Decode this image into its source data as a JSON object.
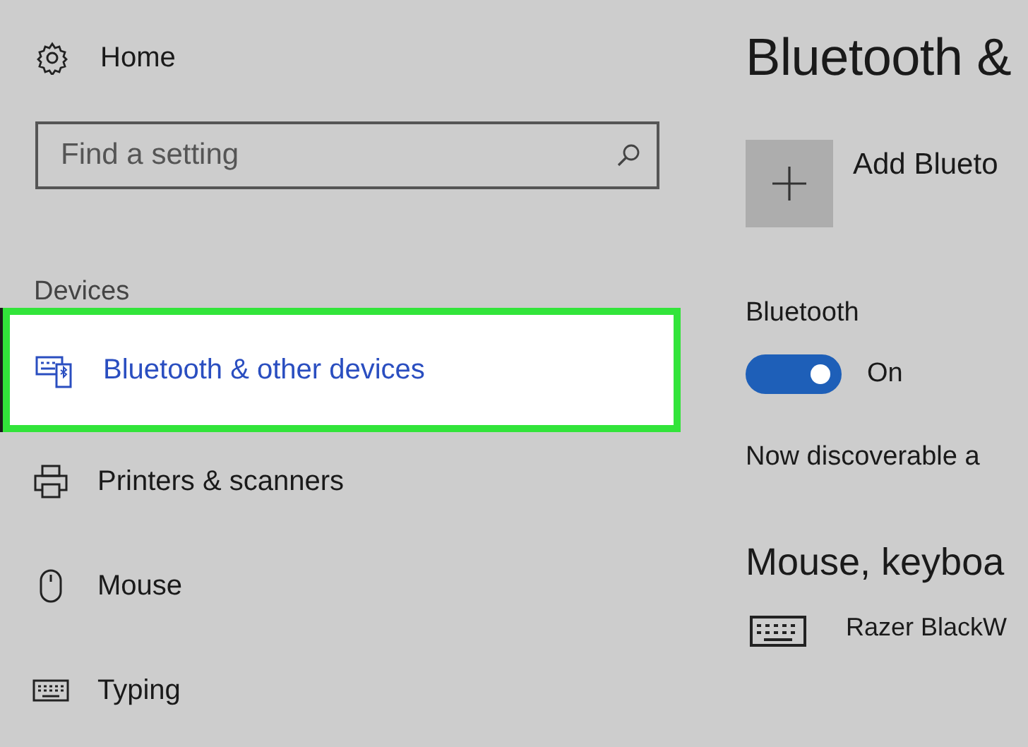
{
  "sidebar": {
    "home": {
      "label": "Home"
    },
    "search": {
      "placeholder": "Find a setting"
    },
    "section": "Devices",
    "items": [
      {
        "label": "Bluetooth & other devices",
        "kind": "bluetooth",
        "selected": true
      },
      {
        "label": "Printers & scanners",
        "kind": "printer",
        "selected": false
      },
      {
        "label": "Mouse",
        "kind": "mouse",
        "selected": false
      },
      {
        "label": "Typing",
        "kind": "keyboard",
        "selected": false
      }
    ]
  },
  "main": {
    "title": "Bluetooth &",
    "add_label": "Add Blueto",
    "bluetooth_label": "Bluetooth",
    "toggle": {
      "on": true,
      "label": "On"
    },
    "discoverable": "Now discoverable a",
    "heading": "Mouse, keyboa",
    "device": "Razer BlackW"
  }
}
